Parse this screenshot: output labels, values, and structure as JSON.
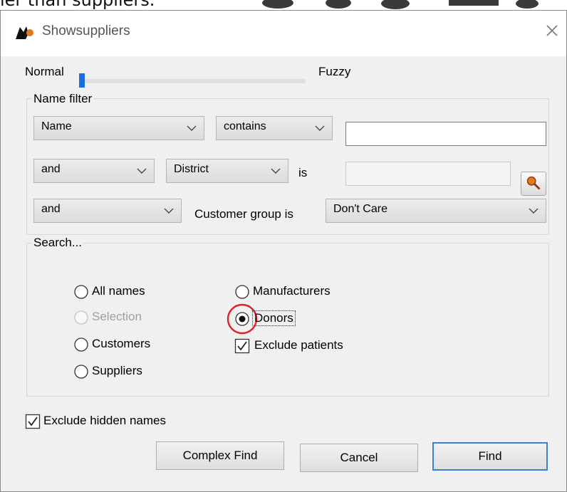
{
  "background_text": "ier than suppliers.",
  "window": {
    "title": "Showsuppliers",
    "icon": "app-icon",
    "close_icon": "close-icon"
  },
  "slider": {
    "left_label": "Normal",
    "right_label": "Fuzzy",
    "value_percent": 0
  },
  "name_filter": {
    "title": "Name filter",
    "row1": {
      "field": "Name",
      "operator": "contains",
      "value": ""
    },
    "row2": {
      "conjunction": "and",
      "field": "District",
      "operator_label": "is",
      "value": ""
    },
    "row3": {
      "conjunction": "and",
      "label": "Customer group is",
      "value": "Don't Care"
    }
  },
  "search": {
    "title": "Search...",
    "options": {
      "all_names": "All names",
      "selection": "Selection",
      "customers": "Customers",
      "suppliers": "Suppliers",
      "manufacturers": "Manufacturers",
      "donors": "Donors"
    },
    "selected": "donors",
    "exclude_patients": {
      "label": "Exclude patients",
      "checked": true
    }
  },
  "exclude_hidden": {
    "label": "Exclude hidden names",
    "checked": true
  },
  "buttons": {
    "complex_find": "Complex Find",
    "cancel": "Cancel",
    "find": "Find"
  },
  "colors": {
    "accent": "#1a6fe0",
    "highlight_ring": "#e0202a",
    "default_button_border": "#3c7fd6"
  }
}
